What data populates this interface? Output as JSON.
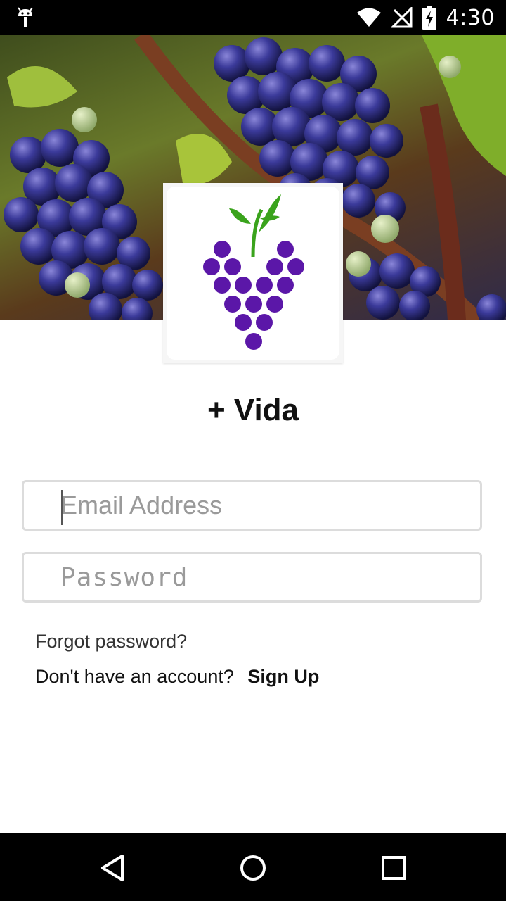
{
  "status_bar": {
    "time": "4:30",
    "icons": [
      "android-debug-icon",
      "wifi-icon",
      "signal-off-icon",
      "battery-charging-icon"
    ]
  },
  "hero": {
    "description_icon": "grapes-vineyard-photo"
  },
  "logo": {
    "icon": "grape-heart-logo-icon",
    "grape_color": "#5b17a8",
    "leaf_color": "#3aa31c"
  },
  "app": {
    "title": "+ Vida"
  },
  "login_form": {
    "email_placeholder": "Email Address",
    "email_value": "",
    "password_placeholder": "Password",
    "password_value": ""
  },
  "links": {
    "forgot_password": "Forgot password?",
    "no_account_prompt": "Don't have an account?",
    "sign_up": "Sign Up"
  },
  "nav_bar": {
    "icons": [
      "back-icon",
      "home-icon",
      "recents-icon"
    ]
  }
}
